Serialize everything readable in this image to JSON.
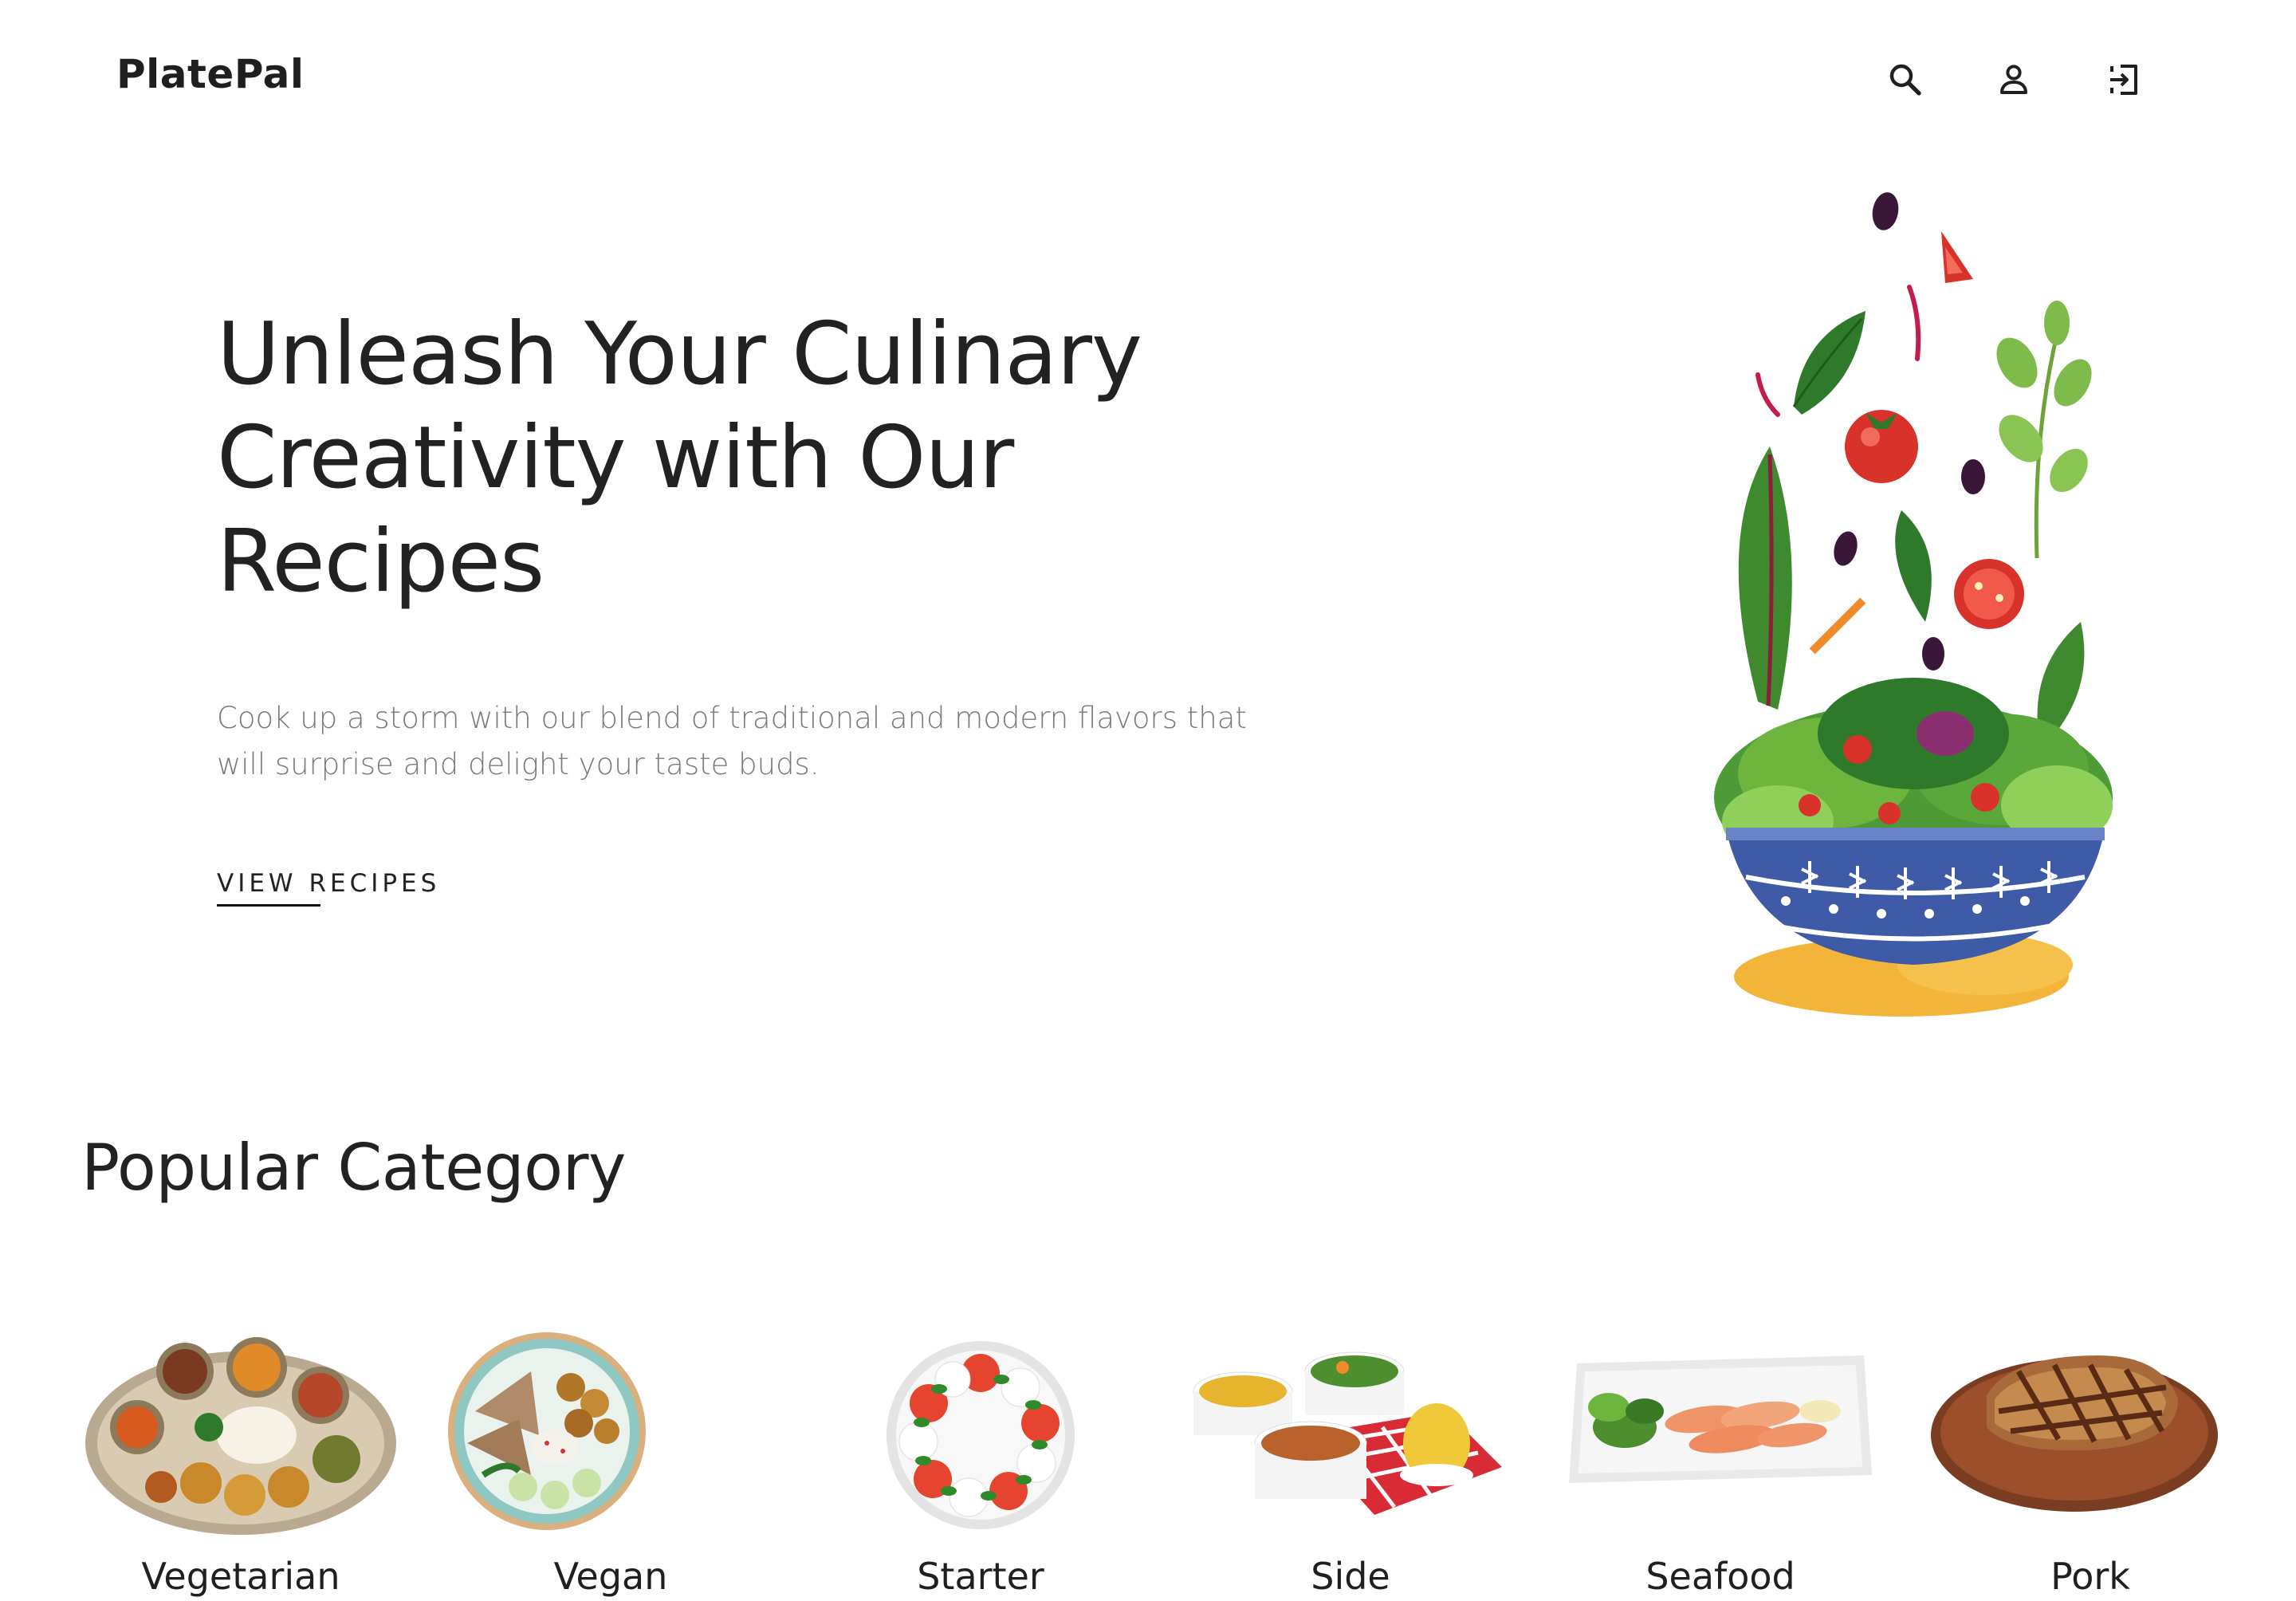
{
  "header": {
    "brand": "PlatePal",
    "icons": [
      "search-icon",
      "account-icon",
      "sign-in-icon"
    ]
  },
  "hero": {
    "title_lines": [
      "Unleash Your Culinary",
      "Creativity with Our",
      "Recipes"
    ],
    "subtitle": "Cook up a storm with our blend of traditional and modern flavors that will surprise and delight your taste buds.",
    "cta_label": "VIEW RECIPES"
  },
  "categories_section": {
    "title": "Popular Category",
    "items": [
      {
        "label": "Vegetarian"
      },
      {
        "label": "Vegan"
      },
      {
        "label": "Starter"
      },
      {
        "label": "Side"
      },
      {
        "label": "Seafood"
      },
      {
        "label": "Pork"
      }
    ]
  },
  "colors": {
    "text": "#222222",
    "muted": "#7a7a7a",
    "bowl_blue": "#3f5aa6",
    "leaf_green": "#3f8a2f",
    "tomato_red": "#d8322b",
    "accent_yellow": "#f2b53a"
  }
}
